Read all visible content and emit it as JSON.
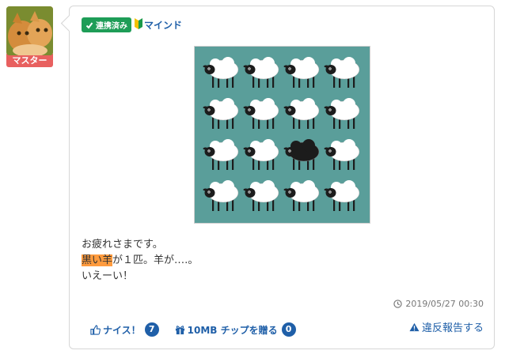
{
  "user": {
    "role_badge": "マスター",
    "linked_badge": "連携済み",
    "name": "マインド"
  },
  "post": {
    "body_line1": "お疲れさまです。",
    "body_line2_highlight": "黒い羊",
    "body_line2_rest": "が１匹。羊が‥‥。",
    "body_line3": "いえーい！",
    "timestamp": "2019/05/27 00:30"
  },
  "actions": {
    "nice_label": "ナイス！",
    "nice_count": "7",
    "tip_label": "10MB チップを贈る",
    "tip_count": "0",
    "report_label": "違反報告する"
  },
  "colors": {
    "accent": "#1f5fa8",
    "linked_green": "#1e9d57",
    "role_red": "#e8605f",
    "highlight_orange": "#ff9b3e",
    "image_bg": "#5a9e9a"
  },
  "icons": [
    "check-icon",
    "beginner-mark-icon",
    "clock-icon",
    "thumbs-up-icon",
    "gift-icon",
    "warning-icon"
  ]
}
